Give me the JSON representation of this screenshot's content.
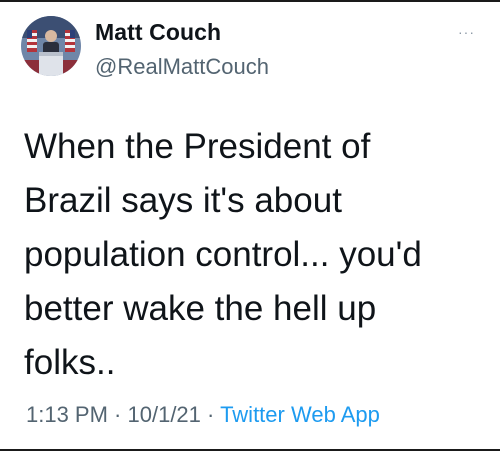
{
  "tweet": {
    "author_name": "Matt Couch",
    "author_handle": "@RealMattCouch",
    "more_label": "···",
    "text": "When the President of\nBrazil says it's about\npopulation control... you'd\nbetter wake the hell up\nfolks..",
    "time": "1:13 PM",
    "separator": " · ",
    "date": "10/1/21",
    "app": "Twitter Web App"
  },
  "colors": {
    "text_primary": "#0f1419",
    "text_secondary": "#536471",
    "link": "#1d9bf0"
  },
  "icons": {
    "avatar": "profile-photo",
    "more": "more-options-icon"
  }
}
